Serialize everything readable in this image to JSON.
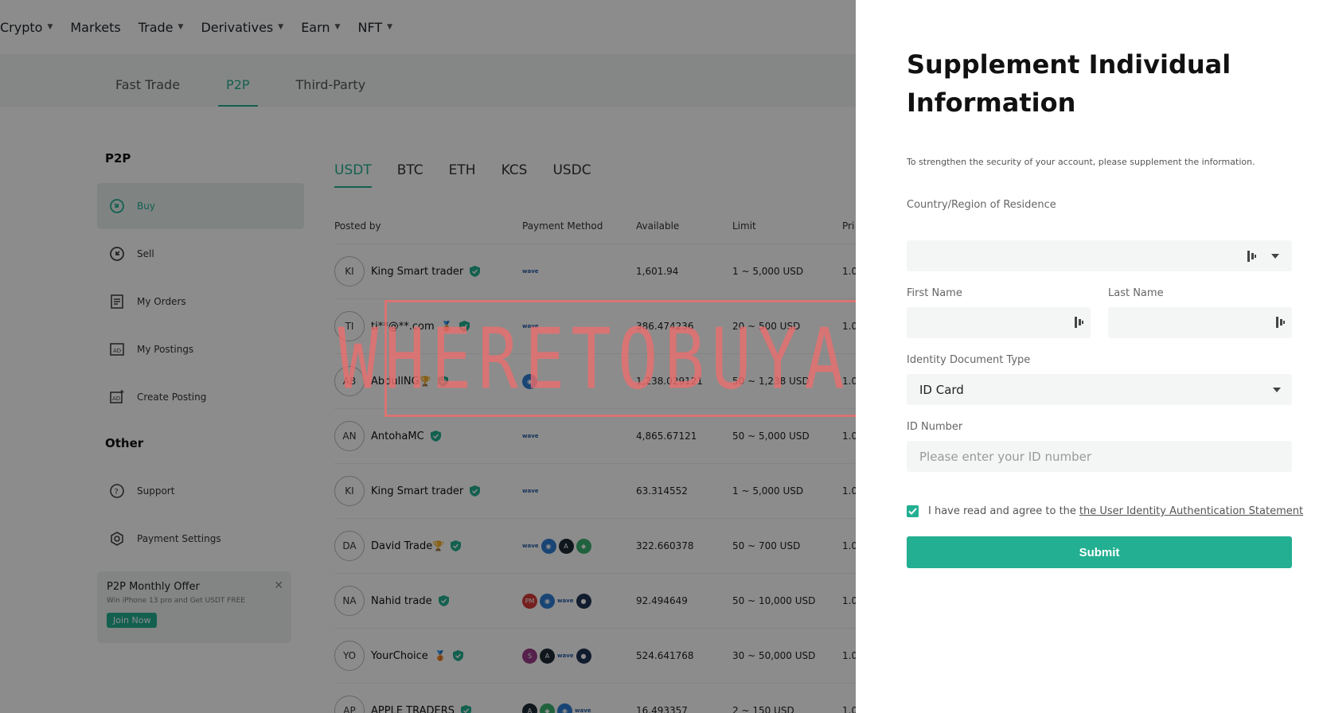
{
  "topnav": {
    "items": [
      {
        "label": "Crypto",
        "caret": true
      },
      {
        "label": "Markets",
        "caret": false
      },
      {
        "label": "Trade",
        "caret": true
      },
      {
        "label": "Derivatives",
        "caret": true
      },
      {
        "label": "Earn",
        "caret": true
      },
      {
        "label": "NFT",
        "caret": true
      }
    ]
  },
  "subnav": {
    "tabs": [
      "Fast Trade",
      "P2P",
      "Third-Party"
    ],
    "active": "P2P"
  },
  "sidebar": {
    "heading": "P2P",
    "items": [
      {
        "label": "Buy",
        "icon": "buy-icon",
        "active": true
      },
      {
        "label": "Sell",
        "icon": "sell-icon",
        "active": false
      },
      {
        "label": "My Orders",
        "icon": "orders-icon",
        "active": false
      },
      {
        "label": "My Postings",
        "icon": "postings-icon",
        "active": false
      },
      {
        "label": "Create Posting",
        "icon": "create-posting-icon",
        "active": false
      }
    ],
    "other_heading": "Other",
    "other_items": [
      {
        "label": "Support",
        "icon": "help-icon"
      },
      {
        "label": "Payment Settings",
        "icon": "settings-icon"
      }
    ],
    "promo": {
      "title": "P2P Monthly Offer",
      "subtitle": "Win iPhone 13 pro and Get USDT FREE",
      "button": "Join Now"
    }
  },
  "coins": {
    "tabs": [
      "USDT",
      "BTC",
      "ETH",
      "KCS",
      "USDC"
    ],
    "active": "USDT"
  },
  "table": {
    "headers": [
      "Posted by",
      "Payment Method",
      "Available",
      "Limit",
      "Pri"
    ],
    "rows": [
      {
        "initials": "KI",
        "name": "King Smart trader",
        "medal": "",
        "payments": [
          "wave"
        ],
        "available": "1,601.94",
        "limit": "1 ~ 5,000 USD",
        "price": "1.0"
      },
      {
        "initials": "TI",
        "name": "ti**@**.com",
        "medal": "gold-medal",
        "payments": [
          "wave"
        ],
        "available": "386.474236",
        "limit": "20 ~ 500 USD",
        "price": "1.0"
      },
      {
        "initials": "AB",
        "name": "AbdullNG",
        "medal": "trophy",
        "payments": [
          "blue"
        ],
        "available": "1,238.029121",
        "limit": "50 ~ 1,238 USD",
        "price": "1.0"
      },
      {
        "initials": "AN",
        "name": "AntohaMC",
        "medal": "",
        "payments": [
          "wave"
        ],
        "available": "4,865.67121",
        "limit": "50 ~ 5,000 USD",
        "price": "1.0"
      },
      {
        "initials": "KI",
        "name": "King Smart trader",
        "medal": "",
        "payments": [
          "wave"
        ],
        "available": "63.314552",
        "limit": "1 ~ 5,000 USD",
        "price": "1.0"
      },
      {
        "initials": "DA",
        "name": "David Trade",
        "medal": "trophy",
        "payments": [
          "wave",
          "blue",
          "dark",
          "green"
        ],
        "available": "322.660378",
        "limit": "50 ~ 700 USD",
        "price": "1.0"
      },
      {
        "initials": "NA",
        "name": "Nahid trade",
        "medal": "",
        "payments": [
          "red",
          "blue",
          "wave",
          "navy"
        ],
        "available": "92.494649",
        "limit": "50 ~ 10,000 USD",
        "price": "1.0"
      },
      {
        "initials": "YO",
        "name": "YourChoice",
        "medal": "gold-medal",
        "payments": [
          "purple",
          "dark",
          "wave",
          "navy"
        ],
        "available": "524.641768",
        "limit": "30 ~ 50,000 USD",
        "price": "1.0"
      },
      {
        "initials": "AP",
        "name": "APPLE TRADERS",
        "medal": "",
        "payments": [
          "dark",
          "green",
          "blue",
          "wave"
        ],
        "available": "16.493357",
        "limit": "2 ~ 150 USD",
        "price": "1.0"
      }
    ]
  },
  "watermark": "WHERETOBUYALTS",
  "drawer": {
    "title": "Supplement Individual Information",
    "note": "To strengthen the security of your account, please supplement the information.",
    "country_label": "Country/Region of Residence",
    "country_value": "",
    "first_name_label": "First Name",
    "last_name_label": "Last Name",
    "doc_type_label": "Identity Document Type",
    "doc_type_value": "ID Card",
    "id_number_label": "ID Number",
    "id_number_placeholder": "Please enter your ID number",
    "agree_text": "I have read and agree to the",
    "agree_link": "the User Identity Authentication Statement",
    "agree_checked": true,
    "submit_label": "Submit"
  },
  "colors": {
    "accent": "#23af91",
    "overlay": "rgba(0,0,0,0.45)",
    "watermark": "#eb6e6e"
  }
}
